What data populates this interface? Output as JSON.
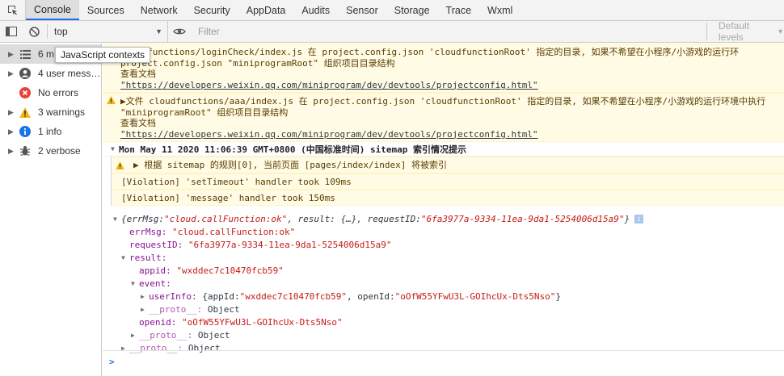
{
  "tabs": [
    "Console",
    "Sources",
    "Network",
    "Security",
    "AppData",
    "Audits",
    "Sensor",
    "Storage",
    "Trace",
    "Wxml"
  ],
  "toolbar": {
    "context": "top",
    "filter_placeholder": "Filter",
    "levels": "Default levels"
  },
  "tooltip": "JavaScript contexts",
  "sidebar": [
    {
      "label": "6 m",
      "icon": "list-icon"
    },
    {
      "label": "4 user mess…",
      "icon": "user-icon"
    },
    {
      "label": "No errors",
      "icon": "error-icon"
    },
    {
      "label": "3 warnings",
      "icon": "warning-icon"
    },
    {
      "label": "1 info",
      "icon": "info-icon"
    },
    {
      "label": "2 verbose",
      "icon": "bug-icon"
    }
  ],
  "warnings": [
    {
      "l1": "cloudfunctions/loginCheck/index.js 在 project.config.json 'cloudfunctionRoot' 指定的目录, 如果不希望在小程序/小游戏的运行环",
      "l2": "project.config.json \"miniprogramRoot\" 组织项目目录结构",
      "l3": "查看文档",
      "l4": "\"https://developers.weixin.qq.com/miniprogram/dev/devtools/projectconfig.html\""
    },
    {
      "l1": "▶文件 cloudfunctions/aaa/index.js 在 project.config.json 'cloudfunctionRoot' 指定的目录, 如果不希望在小程序/小游戏的运行环境中执行",
      "l2": "\"miniprogramRoot\" 组织项目目录结构",
      "l3": "查看文档",
      "l4": "\"https://developers.weixin.qq.com/miniprogram/dev/devtools/projectconfig.html\""
    }
  ],
  "group": {
    "header": "Mon May 11 2020 11:06:39 GMT+0800 (中国标准时间) sitemap 索引情况提示",
    "warning": "▶ 根据 sitemap 的规则[0], 当前页面 [pages/index/index] 将被索引"
  },
  "violations": [
    "[Violation] 'setTimeout' handler took 109ms",
    "[Violation] 'message' handler took 150ms"
  ],
  "object": {
    "summary_pre": "{errMsg: ",
    "summary_err": "\"cloud.callFunction:ok\"",
    "summary_mid": ", result: {…}, requestID: ",
    "summary_req": "\"6fa3977a-9334-11ea-9da1-5254006d15a9\"",
    "summary_end": "}",
    "errMsg_key": "errMsg:",
    "errMsg_val": "\"cloud.callFunction:ok\"",
    "requestID_key": "requestID:",
    "requestID_val": "\"6fa3977a-9334-11ea-9da1-5254006d15a9\"",
    "result_key": "result:",
    "appid_key": "appid:",
    "appid_val": "\"wxddec7c10470fcb59\"",
    "event_key": "event:",
    "userInfo_key": "userInfo:",
    "userInfo_pre": "{appId: ",
    "userInfo_appid": "\"wxddec7c10470fcb59\"",
    "userInfo_mid": ", openId: ",
    "userInfo_openid": "\"oOfW55YFwU3L-GOIhcUx-Dts5Nso\"",
    "userInfo_end": "}",
    "proto_key": "__proto__:",
    "proto_val": "Object",
    "openid_key": "openid:",
    "openid_val": "\"oOfW55YFwU3L-GOIhcUx-Dts5Nso\""
  },
  "prompt": ">"
}
